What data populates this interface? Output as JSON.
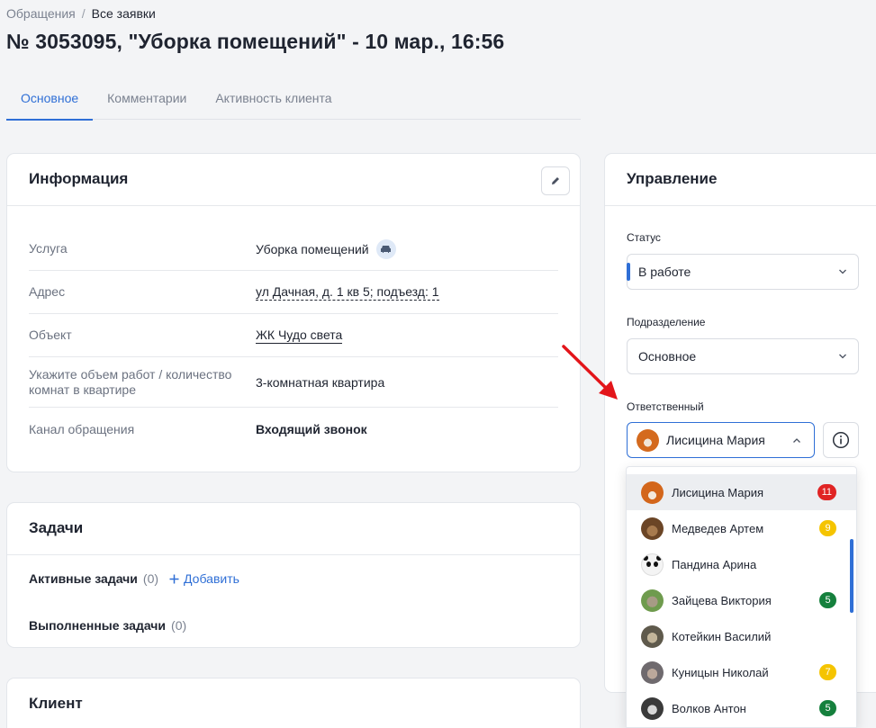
{
  "breadcrumb": {
    "parent": "Обращения",
    "separator": "/",
    "current": "Все заявки"
  },
  "page_title": "№ 3053095, \"Уборка помещений\" - 10 мар., 16:56",
  "tabs": [
    {
      "label": "Основное",
      "active": true
    },
    {
      "label": "Комментарии",
      "active": false
    },
    {
      "label": "Активность клиента",
      "active": false
    }
  ],
  "info": {
    "title": "Информация",
    "edit_icon": "pencil-icon",
    "rows": [
      {
        "label": "Услуга",
        "value": "Уборка помещений",
        "icon": "car-icon"
      },
      {
        "label": "Адрес",
        "value": "ул Дачная, д. 1 кв 5; подъезд: 1"
      },
      {
        "label": "Объект",
        "value": "ЖК Чудо света"
      },
      {
        "label": "Укажите объем работ / количество комнат в квартире",
        "value": "3-комнатная квартира"
      },
      {
        "label": "Канал обращения",
        "value": "Входящий звонок"
      }
    ]
  },
  "tasks": {
    "title": "Задачи",
    "active_label": "Активные задачи",
    "active_count": "(0)",
    "add_label": "Добавить",
    "done_label": "Выполненные задачи",
    "done_count": "(0)"
  },
  "client": {
    "title": "Клиент"
  },
  "management": {
    "title": "Управление",
    "status_label": "Статус",
    "status_value": "В работе",
    "division_label": "Подразделение",
    "division_value": "Основное",
    "assignee_label": "Ответственный",
    "assignee_value": "Лисицина Мария"
  },
  "dropdown": [
    {
      "name": "Лисицина Мария",
      "badge": "11",
      "badge_color": "#e02424",
      "avatar": "fox"
    },
    {
      "name": "Медведев Артем",
      "badge": "9",
      "badge_color": "#f5c400",
      "avatar": "bear"
    },
    {
      "name": "Пандина Арина",
      "badge": "",
      "badge_color": "",
      "avatar": "panda"
    },
    {
      "name": "Зайцева Виктория",
      "badge": "5",
      "badge_color": "#15803d",
      "avatar": "hare"
    },
    {
      "name": "Котейкин Василий",
      "badge": "",
      "badge_color": "",
      "avatar": "cat"
    },
    {
      "name": "Куницын Николай",
      "badge": "7",
      "badge_color": "#f5c400",
      "avatar": "marten"
    },
    {
      "name": "Волков Антон",
      "badge": "5",
      "badge_color": "#15803d",
      "avatar": "wolf"
    }
  ],
  "colors": {
    "accent": "#2f6fd6",
    "annotation_arrow": "#e3151a"
  }
}
